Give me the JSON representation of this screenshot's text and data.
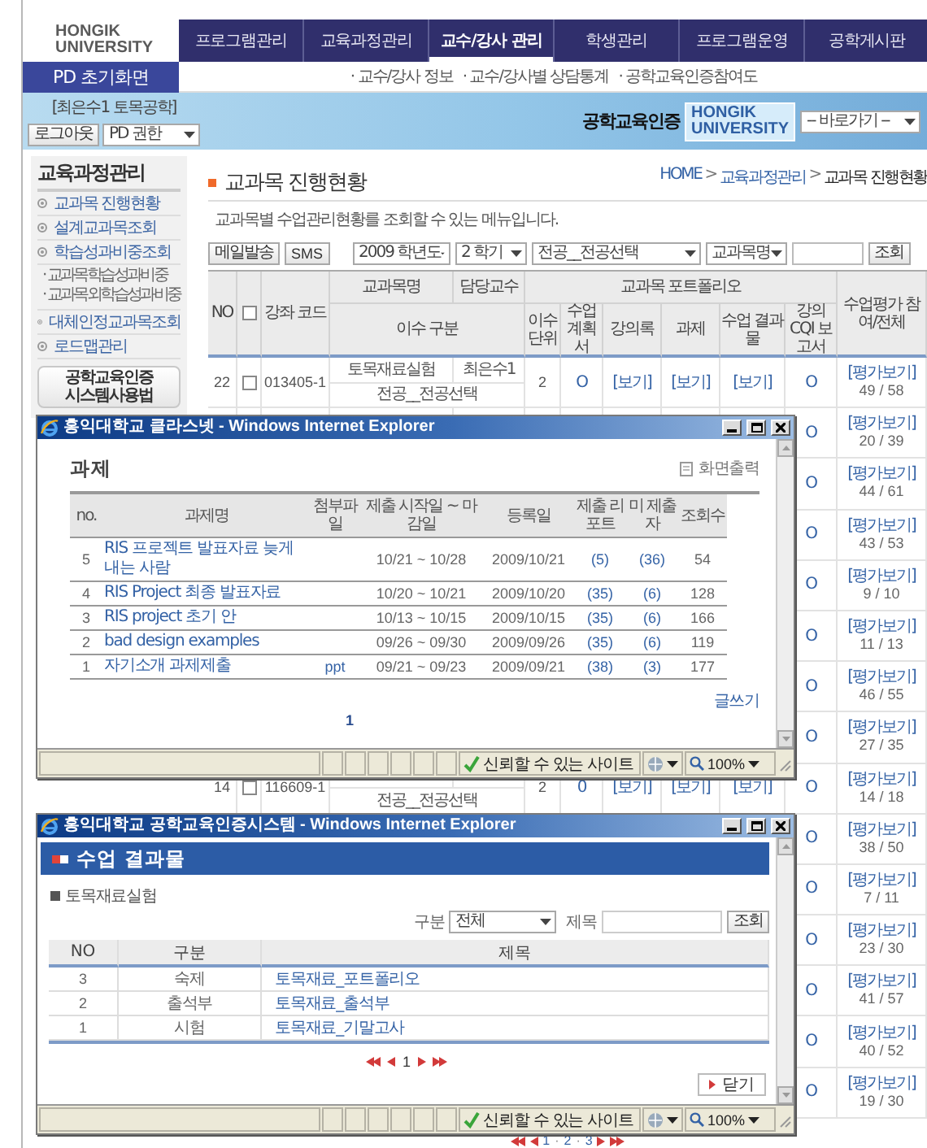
{
  "header": {
    "logo": [
      "HONGIK",
      "UNIVERSITY"
    ],
    "nav": [
      {
        "label": "프로그램관리",
        "selected": false
      },
      {
        "label": "교육과정관리",
        "selected": false
      },
      {
        "label": "교수/강사 관리",
        "selected": true
      },
      {
        "label": "학생관리",
        "selected": false
      },
      {
        "label": "프로그램운영",
        "selected": false
      },
      {
        "label": "공학게시판",
        "selected": false
      }
    ],
    "home_button": "PD 초기화면",
    "sub_nav": [
      "· 교수/강사 정보",
      "· 교수/강사별 상담통계",
      "· 공학교육인증참여도"
    ]
  },
  "user_bar": {
    "user": "[최은수1 토목공학]",
    "logout_button": "로그아웃",
    "role_select": "PD 권한",
    "brand": "공학교육인증",
    "brand_logo": [
      "HONGIK",
      "UNIVERSITY"
    ],
    "quick_select": "-- 바로가기 --"
  },
  "sidebar": {
    "title": "교육과정관리",
    "items": [
      {
        "label": "교과목 진행현황"
      },
      {
        "label": "설계교과목조회"
      },
      {
        "label": "학습성과비중조회",
        "children": [
          {
            "label": "· 교과목학습성과비중"
          },
          {
            "label": "· 교과목외학습성과비중"
          }
        ]
      },
      {
        "label": "대체인정교과목조회"
      },
      {
        "label": "로드맵관리"
      }
    ],
    "guide": [
      "공학교육인증",
      "시스템사용법"
    ]
  },
  "main": {
    "title": "교과목 진행현황",
    "breadcrumb": [
      "HOME",
      "교육과정관리",
      "교과목 진행현황"
    ],
    "breadcrumb_separator": ">",
    "description": "교과목별 수업관리현황를 조회할 수 있는 메뉴입니다.",
    "toolbar": {
      "mail_button": "메일발송",
      "sms_button": "SMS",
      "year_select": "2009 학년도",
      "term_select": "2 학기",
      "type_select": "전공__전공선택",
      "field_select": "교과목명",
      "search_button": "조회"
    },
    "table": {
      "columns": {
        "no": "NO",
        "code": "강좌 코드",
        "name": "교과목명",
        "professor": "담당교수",
        "portfolio": "교과목 포트폴리오",
        "type": "이수 구분",
        "credits": "이수 단위",
        "plan": "수업 계획서",
        "lectures": "강의록",
        "assignments": "과제",
        "results": "수업 결과물",
        "cqi": "강의 CQI 보고서",
        "evaluation": "수업평가 참여/전체"
      },
      "select_all_checked": false,
      "rows": [
        {
          "no": "22",
          "checked": false,
          "code": "013405-1",
          "name": "토목재료실험",
          "professor": "최은수1",
          "type": "전공__전공선택",
          "credits": "2",
          "plan": "O",
          "lectures": "[보기]",
          "assignments": "[보기]",
          "results": "[보기]",
          "cqi": "O",
          "evaluation": "[평가보기]",
          "count": "49 / 58"
        },
        {
          "cqi": "O",
          "evaluation": "[평가보기]",
          "count": "20 / 39"
        },
        {
          "cqi": "O",
          "evaluation": "[평가보기]",
          "count": "44 / 61"
        },
        {
          "cqi": "O",
          "evaluation": "[평가보기]",
          "count": "43 / 53"
        },
        {
          "cqi": "O",
          "evaluation": "[평가보기]",
          "count": "9 / 10"
        },
        {
          "cqi": "O",
          "evaluation": "[평가보기]",
          "count": "11 / 13"
        },
        {
          "cqi": "O",
          "evaluation": "[평가보기]",
          "count": "46 / 55"
        },
        {
          "cqi": "O",
          "evaluation": "[평가보기]",
          "count": "27 / 35"
        },
        {
          "no": "14",
          "checked": false,
          "code": "116609-1",
          "type": "전공__전공선택",
          "credits": "2",
          "plan": "0",
          "lectures": "[보기]",
          "assignments": "[보기]",
          "results": "[보기]",
          "cqi": "O",
          "evaluation": "[평가보기]",
          "count": "14 / 18"
        },
        {
          "cqi": "O",
          "evaluation": "[평가보기]",
          "count": "38 / 50"
        },
        {
          "cqi": "O",
          "evaluation": "[평가보기]",
          "count": "7 / 11"
        },
        {
          "cqi": "O",
          "evaluation": "[평가보기]",
          "count": "23 / 30"
        },
        {
          "cqi": "O",
          "evaluation": "[평가보기]",
          "count": "41 / 57"
        },
        {
          "cqi": "O",
          "evaluation": "[평가보기]",
          "count": "40 / 52"
        },
        {
          "cqi": "O",
          "evaluation": "[평가보기]",
          "count": "19 / 30"
        }
      ]
    },
    "pager": {
      "pages": [
        "1",
        "2",
        "3"
      ],
      "separator": "·"
    }
  },
  "windows": [
    {
      "kind": "assignments",
      "title": "홍익대학교 클라스넷 - Windows Internet Explorer",
      "heading": "과제",
      "print_link": "화면출력",
      "columns": [
        "no.",
        "과제명",
        "첨부파일",
        "제출 시작일 ~ 마감일",
        "등록일",
        "제출 리포트",
        "미 제출자",
        "조회수"
      ],
      "rows": [
        {
          "no": "5",
          "title": "RIS 프로젝트 발표자료 늦게 내는 사람",
          "period": "10/21 ~ 10/28",
          "date": "2009/10/21",
          "reports": "(5)",
          "missing": "(36)",
          "views": "54"
        },
        {
          "no": "4",
          "title": "RIS Project 최종 발표자료",
          "period": "10/20 ~ 10/21",
          "date": "2009/10/20",
          "reports": "(35)",
          "missing": "(6)",
          "views": "128"
        },
        {
          "no": "3",
          "title": "RIS project 초기 안",
          "period": "10/13 ~ 10/15",
          "date": "2009/10/15",
          "reports": "(35)",
          "missing": "(6)",
          "views": "166"
        },
        {
          "no": "2",
          "title": "bad design examples",
          "period": "09/26 ~ 09/30",
          "date": "2009/09/26",
          "reports": "(35)",
          "missing": "(6)",
          "views": "119"
        },
        {
          "no": "1",
          "title": "자기소개 과제제출",
          "attachment": "ppt",
          "period": "09/21 ~ 09/23",
          "date": "2009/09/21",
          "reports": "(38)",
          "missing": "(3)",
          "views": "177"
        }
      ],
      "write_button": "글쓰기",
      "pages": [
        "1"
      ],
      "status": {
        "trust": "신뢰할 수 있는 사이트",
        "zoom": "100%"
      }
    },
    {
      "kind": "results",
      "title": "홍익대학교 공학교육인증시스템 - Windows Internet Explorer",
      "heading": "수업 결과물",
      "course": "토목재료실험",
      "filter_label": "구분",
      "filter_select": "전체",
      "title_label": "제목",
      "search_button": "조회",
      "columns": [
        "NO",
        "구분",
        "제목"
      ],
      "rows": [
        {
          "no": "3",
          "category": "숙제",
          "title": "토목재료_포트폴리오"
        },
        {
          "no": "2",
          "category": "출석부",
          "title": "토목재료_출석부"
        },
        {
          "no": "1",
          "category": "시험",
          "title": "토목재료_기말고사"
        }
      ],
      "pages": [
        "1"
      ],
      "close_button": "닫기",
      "status": {
        "trust": "신뢰할 수 있는 사이트",
        "zoom": "100%"
      }
    }
  ]
}
